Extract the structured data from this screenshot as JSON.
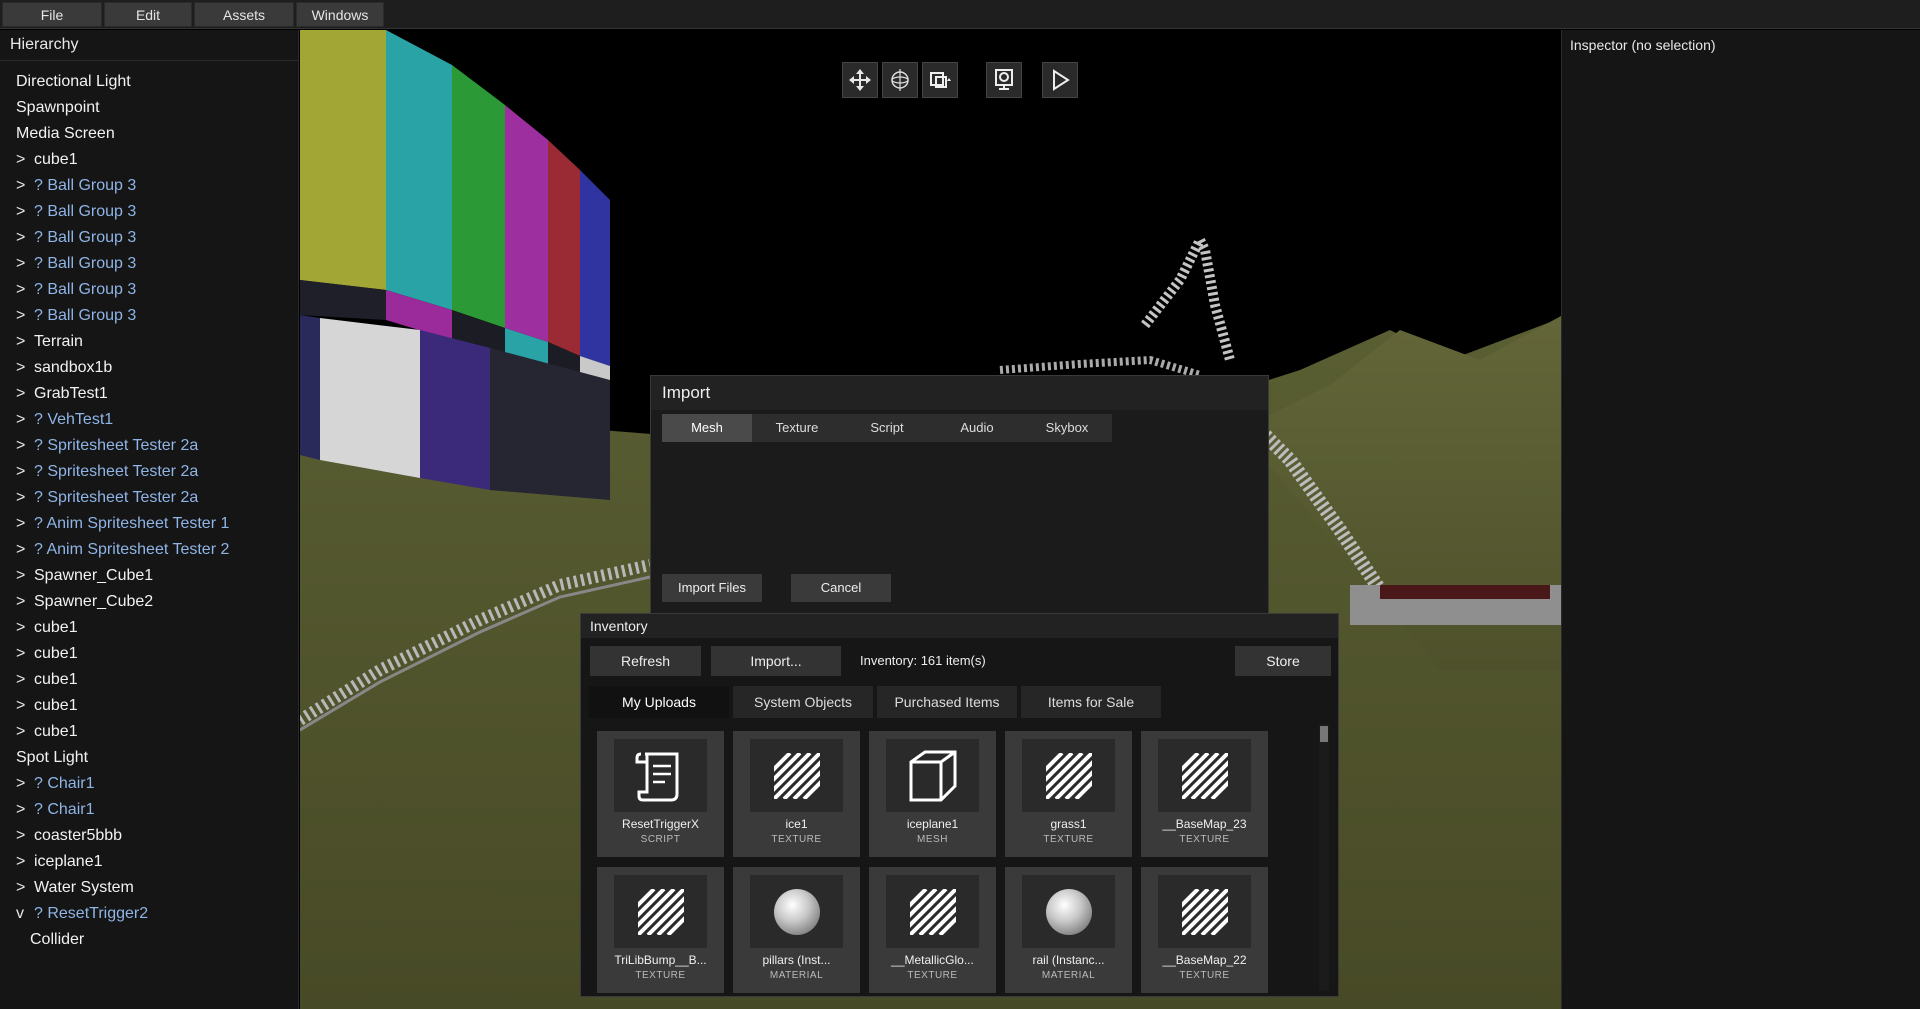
{
  "menu": [
    "File",
    "Edit",
    "Assets",
    "Windows"
  ],
  "hierarchy": {
    "title": "Hierarchy",
    "items": [
      {
        "arrow": "",
        "label": "Directional Light",
        "link": false
      },
      {
        "arrow": "",
        "label": "Spawnpoint",
        "link": false
      },
      {
        "arrow": "",
        "label": "Media Screen",
        "link": false
      },
      {
        "arrow": ">",
        "label": "cube1",
        "link": false
      },
      {
        "arrow": ">",
        "label": "? Ball Group 3",
        "link": true
      },
      {
        "arrow": ">",
        "label": "? Ball Group 3",
        "link": true
      },
      {
        "arrow": ">",
        "label": "? Ball Group 3",
        "link": true
      },
      {
        "arrow": ">",
        "label": "? Ball Group 3",
        "link": true
      },
      {
        "arrow": ">",
        "label": "? Ball Group 3",
        "link": true
      },
      {
        "arrow": ">",
        "label": "? Ball Group 3",
        "link": true
      },
      {
        "arrow": ">",
        "label": "Terrain",
        "link": false
      },
      {
        "arrow": ">",
        "label": "sandbox1b",
        "link": false
      },
      {
        "arrow": ">",
        "label": "GrabTest1",
        "link": false
      },
      {
        "arrow": ">",
        "label": "? VehTest1",
        "link": true
      },
      {
        "arrow": ">",
        "label": "? Spritesheet Tester 2a",
        "link": true
      },
      {
        "arrow": ">",
        "label": "? Spritesheet Tester 2a",
        "link": true
      },
      {
        "arrow": ">",
        "label": "? Spritesheet Tester 2a",
        "link": true
      },
      {
        "arrow": ">",
        "label": "? Anim Spritesheet Tester 1",
        "link": true
      },
      {
        "arrow": ">",
        "label": "? Anim Spritesheet Tester 2",
        "link": true
      },
      {
        "arrow": ">",
        "label": "Spawner_Cube1",
        "link": false
      },
      {
        "arrow": ">",
        "label": "Spawner_Cube2",
        "link": false
      },
      {
        "arrow": ">",
        "label": "cube1",
        "link": false
      },
      {
        "arrow": ">",
        "label": "cube1",
        "link": false
      },
      {
        "arrow": ">",
        "label": "cube1",
        "link": false
      },
      {
        "arrow": ">",
        "label": "cube1",
        "link": false
      },
      {
        "arrow": ">",
        "label": "cube1",
        "link": false
      },
      {
        "arrow": "",
        "label": "Spot Light",
        "link": false
      },
      {
        "arrow": ">",
        "label": "? Chair1",
        "link": true
      },
      {
        "arrow": ">",
        "label": "? Chair1",
        "link": true
      },
      {
        "arrow": ">",
        "label": "coaster5bbb",
        "link": false
      },
      {
        "arrow": ">",
        "label": "iceplane1",
        "link": false
      },
      {
        "arrow": ">",
        "label": "Water System",
        "link": false
      },
      {
        "arrow": "v",
        "label": "? ResetTrigger2",
        "link": true
      },
      {
        "arrow": "",
        "label": "Collider",
        "link": false,
        "indent": true
      }
    ]
  },
  "inspector": {
    "title": "Inspector (no selection)"
  },
  "viewport_tools": [
    {
      "name": "move-tool-icon"
    },
    {
      "name": "rotate-tool-icon"
    },
    {
      "name": "scale-tool-icon"
    },
    {
      "name": "camera-icon"
    },
    {
      "name": "play-icon"
    }
  ],
  "import_dialog": {
    "title": "Import",
    "tabs": [
      "Mesh",
      "Texture",
      "Script",
      "Audio",
      "Skybox"
    ],
    "active_tab": "Mesh",
    "import_files": "Import Files",
    "cancel": "Cancel"
  },
  "inventory": {
    "title": "Inventory",
    "refresh": "Refresh",
    "import": "Import...",
    "count": "Inventory: 161 item(s)",
    "store": "Store",
    "tabs": [
      "My Uploads",
      "System Objects",
      "Purchased Items",
      "Items for Sale"
    ],
    "active_tab": "My Uploads",
    "items": [
      {
        "name": "ResetTriggerX",
        "type": "SCRIPT",
        "icon": "script-icon"
      },
      {
        "name": "ice1",
        "type": "TEXTURE",
        "icon": "texture-icon"
      },
      {
        "name": "iceplane1",
        "type": "MESH",
        "icon": "mesh-icon"
      },
      {
        "name": "grass1",
        "type": "TEXTURE",
        "icon": "texture-icon"
      },
      {
        "name": "__BaseMap_23",
        "type": "TEXTURE",
        "icon": "texture-icon"
      },
      {
        "name": "TriLibBump__B...",
        "type": "TEXTURE",
        "icon": "texture-icon"
      },
      {
        "name": "pillars (Inst...",
        "type": "MATERIAL",
        "icon": "material-icon"
      },
      {
        "name": "__MetallicGlo...",
        "type": "TEXTURE",
        "icon": "texture-icon"
      },
      {
        "name": "rail (Instanc...",
        "type": "MATERIAL",
        "icon": "material-icon"
      },
      {
        "name": "__BaseMap_22",
        "type": "TEXTURE",
        "icon": "texture-icon"
      }
    ]
  },
  "colors": {
    "link": "#8fb4e6",
    "panel_bg": "#151515",
    "grass": "#54582e",
    "sky": "#000000"
  }
}
